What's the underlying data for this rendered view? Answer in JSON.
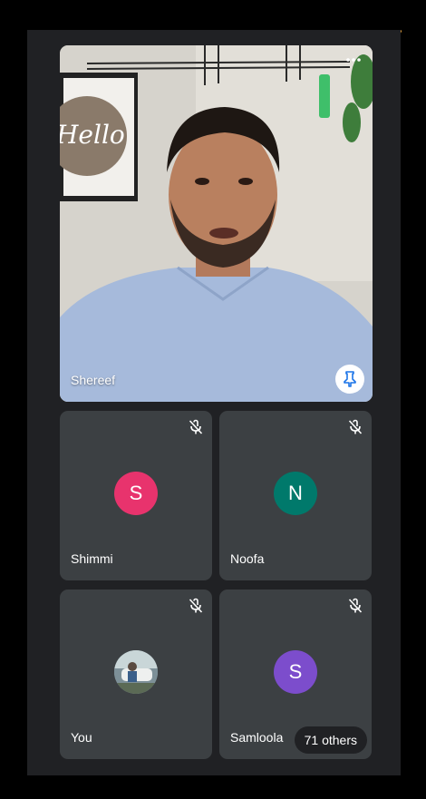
{
  "main_participant": {
    "name": "Shereef",
    "menu_icon": "more-horizontal-icon",
    "pin_icon": "pin-icon"
  },
  "participants": [
    {
      "name": "Shimmi",
      "initial": "S",
      "avatar_color": "#e8336d",
      "muted": true
    },
    {
      "name": "Noofa",
      "initial": "N",
      "avatar_color": "#00796b",
      "muted": true
    },
    {
      "name": "You",
      "initial": "",
      "avatar_color": "#8a9aa0",
      "muted": true
    },
    {
      "name": "Samloola",
      "initial": "S",
      "avatar_color": "#7c4dcc",
      "muted": true
    }
  ],
  "overflow_label": "71 others",
  "colors": {
    "background": "#202124",
    "tile": "#3c4043",
    "accent_blue": "#1a73e8"
  }
}
